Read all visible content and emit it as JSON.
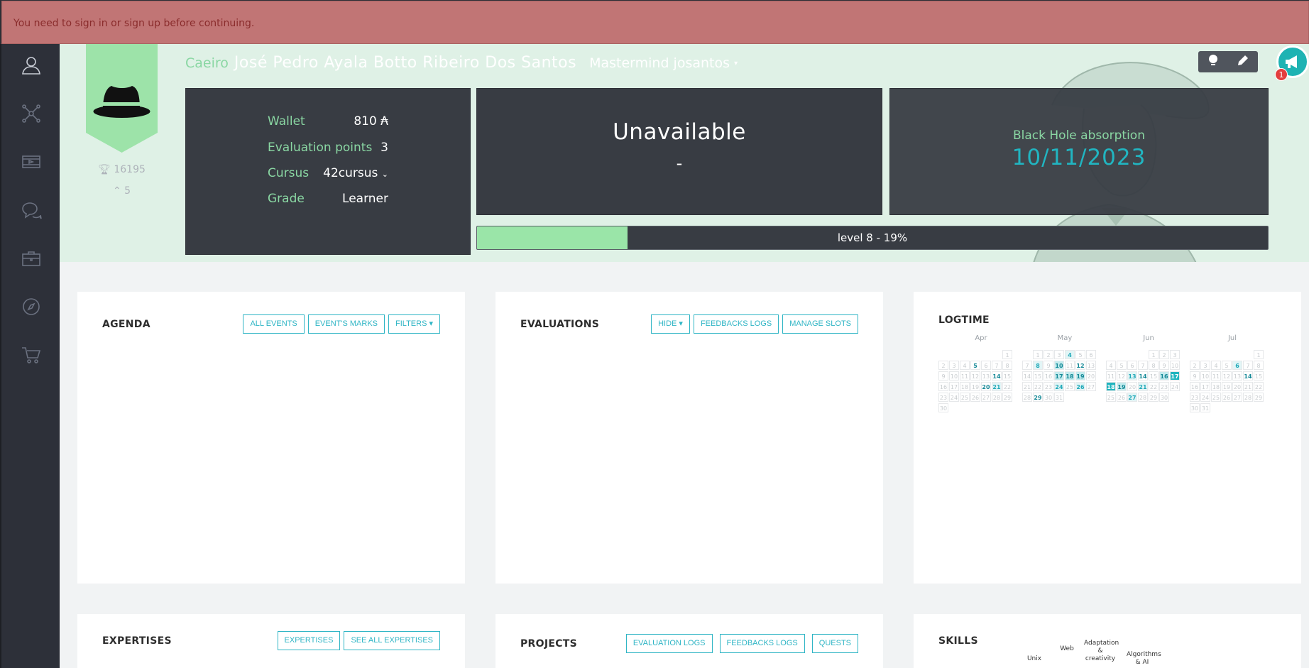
{
  "alert": {
    "message": "You need to sign in or sign up before continuing."
  },
  "sidebar": {
    "items": [
      "profile-icon",
      "network-icon",
      "video-icon",
      "chat-icon",
      "briefcase-icon",
      "compass-icon",
      "cart-icon"
    ]
  },
  "user": {
    "login": "Caeiro",
    "full_name": "José Pedro Ayala Botto Ribeiro Dos Santos",
    "title": "Mastermind josantos",
    "correction_points": "16195",
    "rank": "5"
  },
  "info": {
    "wallet_label": "Wallet",
    "wallet_value": "810 ₳",
    "eval_label": "Evaluation points",
    "eval_value": "3",
    "cursus_label": "Cursus",
    "cursus_value": "42cursus",
    "grade_label": "Grade",
    "grade_value": "Learner"
  },
  "availability": {
    "status": "Unavailable",
    "location": "-"
  },
  "black_hole": {
    "label": "Black Hole absorption",
    "date": "10/11/2023"
  },
  "level": {
    "text": "level 8 - 19%",
    "progress": 0.19
  },
  "notifications": {
    "count": "1"
  },
  "agenda": {
    "title": "AGENDA",
    "buttons": [
      "ALL EVENTS",
      "EVENT'S MARKS",
      "FILTERS ▾"
    ]
  },
  "evaluations": {
    "title": "EVALUATIONS",
    "buttons": [
      "HIDE ▾",
      "FEEDBACKS LOGS",
      "MANAGE SLOTS"
    ]
  },
  "logtime": {
    "title": "LOGTIME",
    "months": [
      {
        "name": "Apr",
        "offset": 6,
        "days": 30,
        "marks": {
          "5": "b",
          "14": "b",
          "20": "b",
          "21": "l1"
        }
      },
      {
        "name": "May",
        "offset": 1,
        "days": 31,
        "marks": {
          "4": "l1",
          "8": "l1",
          "10": "l2",
          "12": "b",
          "17": "l2",
          "18": "l2",
          "19": "l2",
          "24": "l1",
          "26": "l1",
          "29": "b"
        }
      },
      {
        "name": "Jun",
        "offset": 4,
        "days": 30,
        "marks": {
          "13": "l1",
          "14": "b",
          "16": "l2",
          "17": "l3",
          "18": "l3",
          "19": "l2",
          "21": "l1",
          "27": "l1"
        }
      },
      {
        "name": "Jul",
        "offset": 6,
        "days": 31,
        "marks": {
          "6": "l1",
          "14": "b"
        }
      }
    ]
  },
  "expertises": {
    "title": "EXPERTISES",
    "buttons": [
      "EXPERTISES",
      "SEE ALL EXPERTISES"
    ]
  },
  "projects": {
    "title": "PROJECTS",
    "buttons": [
      "EVALUATION LOGS",
      "FEEDBACKS LOGS",
      "QUESTS"
    ]
  },
  "skills": {
    "title": "SKILLS",
    "labels": [
      "Unix",
      "Web",
      "Adaptation & creativity",
      "Algorithms & AI"
    ]
  }
}
